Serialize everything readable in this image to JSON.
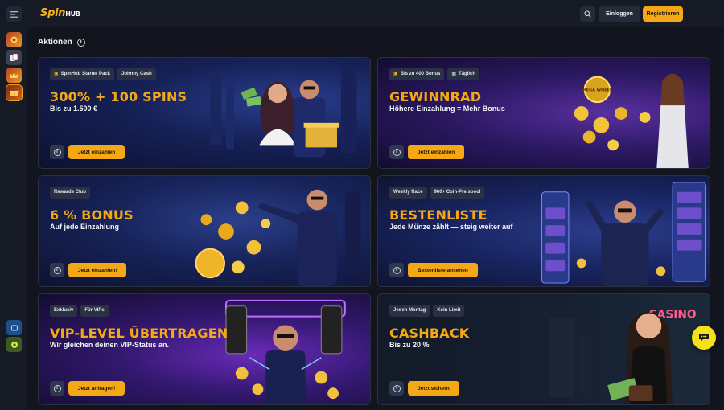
{
  "brand": {
    "logo_main": "Spin",
    "logo_accent": "HUB"
  },
  "header": {
    "login_label": "Einloggen",
    "register_label": "Registrieren"
  },
  "section": {
    "title": "Aktionen"
  },
  "cards": [
    {
      "tags": [
        "SpinHub Starter Pack",
        "Johnny Cash"
      ],
      "tag_icons": [
        "gift-icon",
        ""
      ],
      "title": "300% + 100 SPINS",
      "subtitle": "Bis zu 1.500 €",
      "cta": "Jetzt einzahlen",
      "accent": "#1b2a6b"
    },
    {
      "tags": [
        "Bis zu 400 Bonus",
        "Täglich"
      ],
      "tag_icons": [
        "gift-icon",
        "calendar-icon"
      ],
      "title": "GEWINNRAD",
      "subtitle": "Höhere Einzahlung = Mehr Bonus",
      "cta": "Jetzt einzahlen",
      "accent": "#3a1f6e",
      "art_text": "MEGA WHEEL"
    },
    {
      "tags": [
        "Rewards Club"
      ],
      "tag_icons": [
        ""
      ],
      "title": "6 % BONUS",
      "subtitle": "Auf jede Einzahlung",
      "cta": "Jetzt einzahlen!",
      "accent": "#1a2a5c"
    },
    {
      "tags": [
        "Weekly Race",
        "960+ Coin-Preispool"
      ],
      "tag_icons": [
        "",
        ""
      ],
      "title": "BESTENLISTE",
      "subtitle": "Jede Münze zählt — steig weiter auf",
      "cta": "Bestenliste ansehen",
      "accent": "#1f2d66"
    },
    {
      "tags": [
        "Exklusiv",
        "Für VIPs"
      ],
      "tag_icons": [
        "",
        ""
      ],
      "title": "VIP-LEVEL ÜBERTRAGEN",
      "subtitle": "Wir gleichen deinen VIP-Status an.",
      "cta": "Jetzt anfragen!",
      "accent": "#3a1860"
    },
    {
      "tags": [
        "Jeden Montag",
        "Kein Limit"
      ],
      "tag_icons": [
        "",
        ""
      ],
      "title": "CASHBACK",
      "subtitle": "Bis zu 20 %",
      "cta": "Jetzt sichern",
      "accent": "#121a2a",
      "art_text": "CASINO"
    }
  ],
  "colors": {
    "accent": "#f5a815",
    "background": "#12151d",
    "panel": "#161a24",
    "chat": "#f4e11a"
  }
}
